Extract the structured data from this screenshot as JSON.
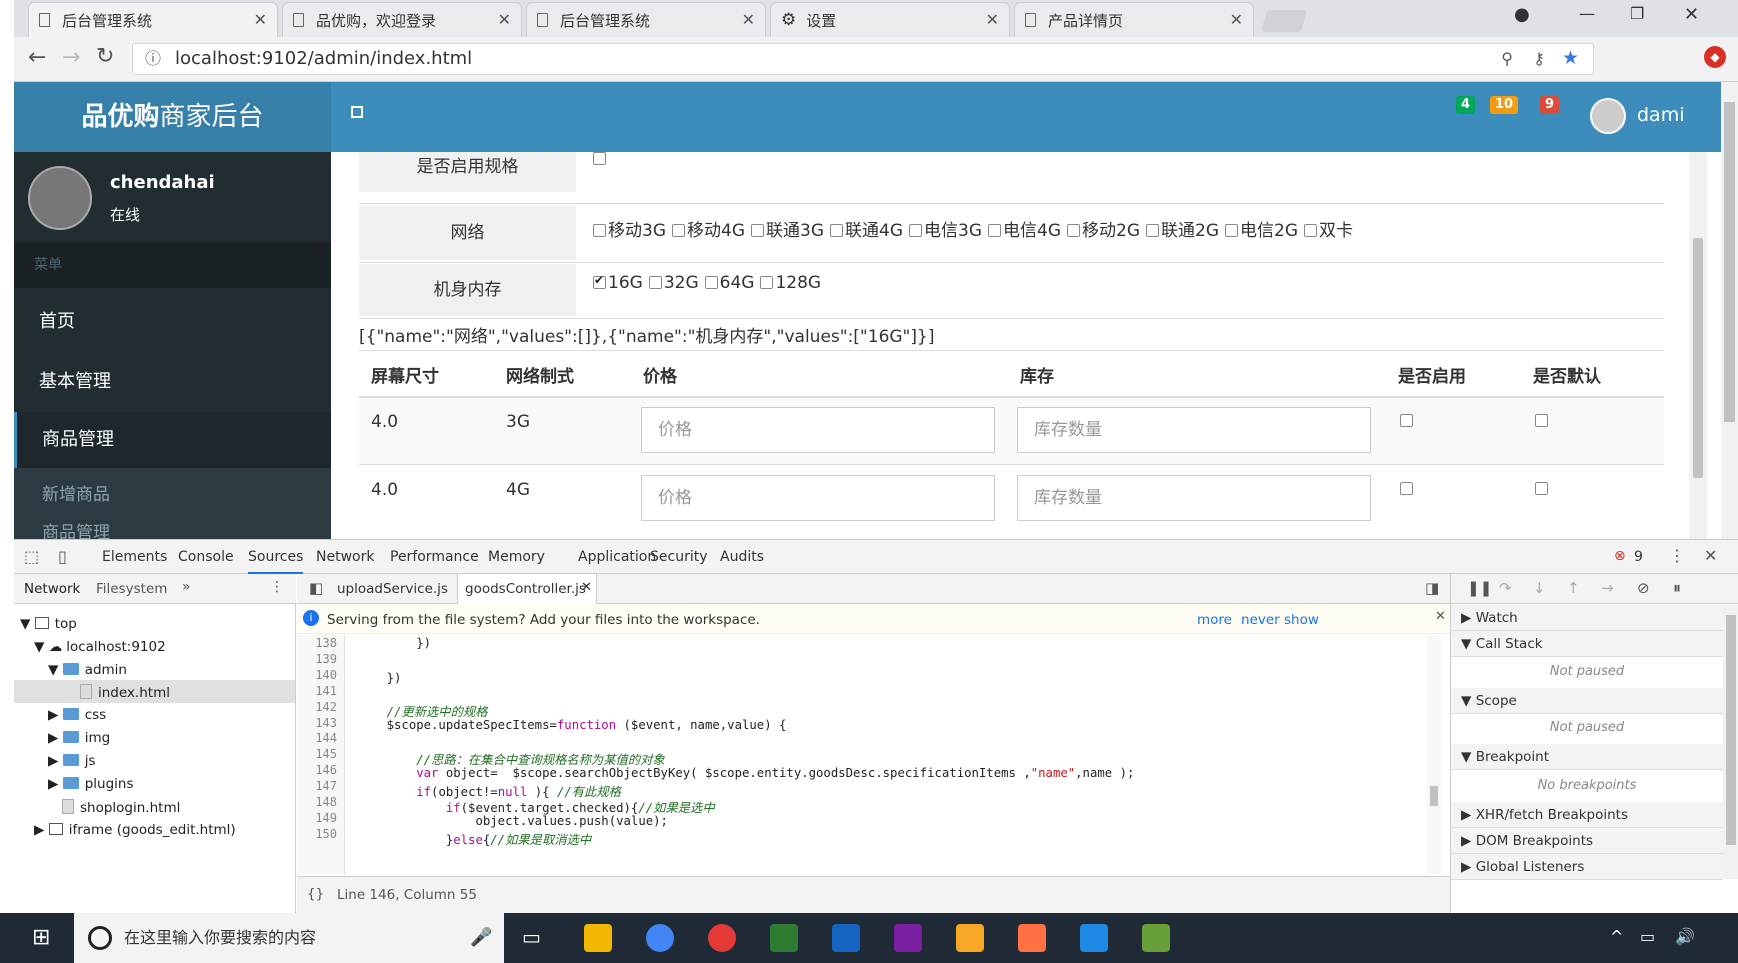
{
  "browser": {
    "tabs": [
      {
        "title": "后台管理系统"
      },
      {
        "title": "品优购，欢迎登录"
      },
      {
        "title": "后台管理系统"
      },
      {
        "title": "设置"
      },
      {
        "title": "产品详情页"
      }
    ],
    "url": "localhost:9102/admin/index.html"
  },
  "app": {
    "logo_bold": "品优购",
    "logo_light": "商家后台",
    "badges": [
      "4",
      "10",
      "9"
    ],
    "header_user": "dami",
    "sidebar_user": "chendahai",
    "sidebar_status": "在线",
    "menu_header": "菜单",
    "menu": [
      "首页",
      "基本管理",
      "商品管理"
    ],
    "submenu": [
      "新增商品",
      "商品管理"
    ]
  },
  "form": {
    "spec_enable_label": "是否启用规格",
    "network_label": "网络",
    "network_options": [
      "移动3G",
      "移动4G",
      "联通3G",
      "联通4G",
      "电信3G",
      "电信4G",
      "移动2G",
      "联通2G",
      "电信2G",
      "双卡"
    ],
    "memory_label": "机身内存",
    "memory_options": [
      "16G",
      "32G",
      "64G",
      "128G"
    ],
    "json_output": "[{\"name\":\"网络\",\"values\":[]},{\"name\":\"机身内存\",\"values\":[\"16G\"]}]",
    "table_headers": [
      "屏幕尺寸",
      "网络制式",
      "价格",
      "库存",
      "是否启用",
      "是否默认"
    ],
    "rows": [
      {
        "size": "4.0",
        "net": "3G"
      },
      {
        "size": "4.0",
        "net": "4G"
      }
    ],
    "price_placeholder": "价格",
    "stock_placeholder": "库存数量"
  },
  "devtools": {
    "tabs": [
      "Elements",
      "Console",
      "Sources",
      "Network",
      "Performance",
      "Memory",
      "Application",
      "Security",
      "Audits"
    ],
    "error_count": "9",
    "nav_tabs": [
      "Network",
      "Filesystem"
    ],
    "tree": [
      "top",
      "localhost:9102",
      "admin",
      "index.html",
      "css",
      "img",
      "js",
      "plugins",
      "shoplogin.html",
      "iframe (goods_edit.html)"
    ],
    "file_tabs": [
      "uploadService.js",
      "goodsController.js"
    ],
    "info_bar": "Serving from the file system? Add your files into the workspace.",
    "info_more": "more",
    "info_never": "never show",
    "line_numbers": [
      "138",
      "139",
      "140",
      "141",
      "142",
      "143",
      "144",
      "145",
      "146",
      "147",
      "148",
      "149",
      "150"
    ],
    "status": "Line 146, Column 55",
    "right_sections": [
      "Watch",
      "Call Stack",
      "Scope",
      "Breakpoint",
      "XHR/fetch Breakpoints",
      "DOM Breakpoints",
      "Global Listeners"
    ],
    "not_paused": "Not paused",
    "no_breakpoints": "No breakpoints"
  },
  "taskbar": {
    "search_placeholder": "在这里输入你要搜索的内容"
  }
}
